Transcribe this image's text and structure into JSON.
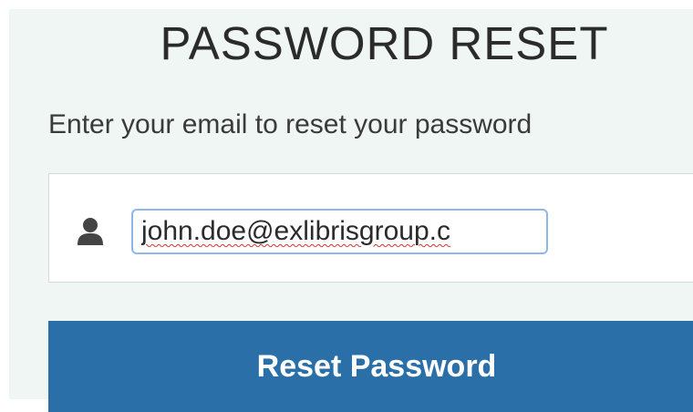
{
  "page": {
    "title": "PASSWORD RESET",
    "subtitle": "Enter your email to reset your password"
  },
  "form": {
    "email_value": "john.doe@exlibrisgroup.c",
    "email_icon": "user-icon",
    "submit_label": "Reset Password"
  },
  "colors": {
    "panel_background": "#eff6f4",
    "button_background": "#2a6fa8",
    "input_focus_border": "#8fb8ea",
    "spellcheck_underline": "#e03030"
  }
}
